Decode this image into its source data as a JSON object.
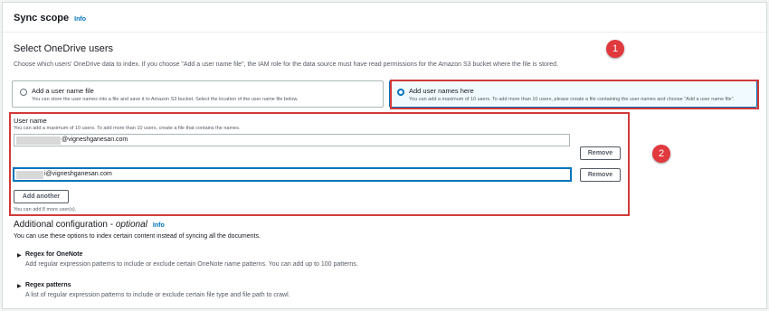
{
  "sync_scope": {
    "title": "Sync scope",
    "info": "Info"
  },
  "onedrive": {
    "heading": "Select OneDrive users",
    "description": "Choose which users' OneDrive data to index. If you choose \"Add a user name file\", the IAM role for the data source must have read permissions for the Amazon S3 bucket where the file is stored.",
    "option_file": {
      "label": "Add a user name file",
      "description": "You can store the user names into a file and save it to Amazon S3 bucket. Select the location of the user name file below."
    },
    "option_names": {
      "label": "Add user names here",
      "description": "You can add a maximum of 10 users. To add more than 10 users, please create a file containing the user names and choose \"Add a user name file\"."
    }
  },
  "user_name": {
    "label": "User name",
    "hint": "You can add a maximum of 10 users. To add more than 10 users, create a file that contains the names.",
    "entries": [
      {
        "value": "@vigneshganesan.com"
      },
      {
        "value": "i@vigneshganesan.com"
      }
    ],
    "remove_label": "Remove",
    "add_another_label": "Add another",
    "remaining": "You can add 8 more user(s)."
  },
  "additional": {
    "heading_plain": "Additional configuration - ",
    "heading_italic": "optional",
    "info": "Info",
    "description": "You can use these options to index certain content instead of syncing all the documents.",
    "regex_onenote": {
      "title": "Regex for OneNote",
      "description": "Add regular expression patterns to include or exclude certain OneNote name patterns. You can add up to 100 patterns."
    },
    "regex_patterns": {
      "title": "Regex patterns",
      "description": "A list of regular expression patterns to include or exclude certain file type and file path to crawl."
    }
  },
  "annotations": {
    "badge1": "1",
    "badge2": "2"
  },
  "colors": {
    "accent": "#0073bb",
    "callout": "#d13a3a",
    "badge": "#e0393e"
  }
}
